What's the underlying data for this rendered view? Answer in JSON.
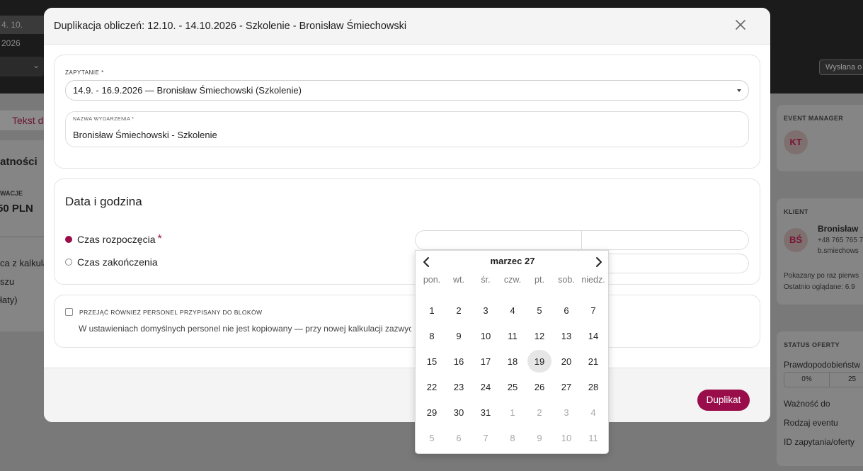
{
  "background": {
    "topbar_date": "4. 10. 2026",
    "status_chip": "Wysłana o",
    "tab_label": "Tekst dla",
    "left_card": {
      "heading": "łatności",
      "small_label": "WACJE",
      "amount": "50 PLN",
      "row1": "ca z kalkula",
      "row2": "szu",
      "row3": "łaty)"
    },
    "event_manager": {
      "label": "EVENT MANAGER",
      "initials": "KT"
    },
    "client": {
      "label": "KLIENT",
      "initials": "BŚ",
      "name": "Bronisław",
      "phone": "+48 765 765 7",
      "email": "b.smiechows",
      "first_shown": "Pokazany po raz pierws",
      "last_viewed": "Ostatnio oglądane: 6.9"
    },
    "offer_status": {
      "label": "STATUS OFERTY",
      "probability_label": "Prawdopodobieństw",
      "probability_options": [
        "0%",
        "25"
      ],
      "valid_until": "Ważność do",
      "event_type": "Rodzaj eventu",
      "inquiry_id": "ID zapytania/oferty"
    }
  },
  "modal": {
    "title": "Duplikacja obliczeń: 12.10. - 14.10.2026 - Szkolenie - Bronisław Śmiechowski",
    "inquiry": {
      "label": "Zapytanie *",
      "value": "14.9. - 16.9.2026 — Bronisław Śmiechowski (Szkolenie)"
    },
    "event_name": {
      "label": "Nazwa wydarzenia *",
      "value": "Bronisław Śmiechowski - Szkolenie"
    },
    "datetime": {
      "heading": "Data i godzina",
      "start_label": "Czas rozpoczęcia",
      "required_mark": "*",
      "end_label": "Czas zakończenia"
    },
    "staff": {
      "checkbox_label": "Przejąć również personel przypisany do bloków",
      "description": "W ustawieniach domyślnych personel nie jest kopiowany — przy nowej kalkulacji zazwyczaj"
    },
    "submit_label": "Duplikat"
  },
  "datepicker": {
    "month_label": "marzec 27",
    "weekdays": [
      "pon.",
      "wt.",
      "śr.",
      "czw.",
      "pt.",
      "sob.",
      "niedz."
    ],
    "selected_day": "19",
    "days": [
      {
        "d": "1",
        "m": false
      },
      {
        "d": "2",
        "m": false
      },
      {
        "d": "3",
        "m": false
      },
      {
        "d": "4",
        "m": false
      },
      {
        "d": "5",
        "m": false
      },
      {
        "d": "6",
        "m": false
      },
      {
        "d": "7",
        "m": false
      },
      {
        "d": "8",
        "m": false
      },
      {
        "d": "9",
        "m": false
      },
      {
        "d": "10",
        "m": false
      },
      {
        "d": "11",
        "m": false
      },
      {
        "d": "12",
        "m": false
      },
      {
        "d": "13",
        "m": false
      },
      {
        "d": "14",
        "m": false
      },
      {
        "d": "15",
        "m": false
      },
      {
        "d": "16",
        "m": false
      },
      {
        "d": "17",
        "m": false
      },
      {
        "d": "18",
        "m": false
      },
      {
        "d": "19",
        "m": false
      },
      {
        "d": "20",
        "m": false
      },
      {
        "d": "21",
        "m": false
      },
      {
        "d": "22",
        "m": false
      },
      {
        "d": "23",
        "m": false
      },
      {
        "d": "24",
        "m": false
      },
      {
        "d": "25",
        "m": false
      },
      {
        "d": "26",
        "m": false
      },
      {
        "d": "27",
        "m": false
      },
      {
        "d": "28",
        "m": false
      },
      {
        "d": "29",
        "m": false
      },
      {
        "d": "30",
        "m": false
      },
      {
        "d": "31",
        "m": false
      },
      {
        "d": "1",
        "m": true
      },
      {
        "d": "2",
        "m": true
      },
      {
        "d": "3",
        "m": true
      },
      {
        "d": "4",
        "m": true
      },
      {
        "d": "5",
        "m": true
      },
      {
        "d": "6",
        "m": true
      },
      {
        "d": "7",
        "m": true
      },
      {
        "d": "8",
        "m": true
      },
      {
        "d": "9",
        "m": true
      },
      {
        "d": "10",
        "m": true
      },
      {
        "d": "11",
        "m": true
      }
    ]
  },
  "colors": {
    "accent": "#9a0d4b",
    "overlay": "#7d7d7d"
  }
}
